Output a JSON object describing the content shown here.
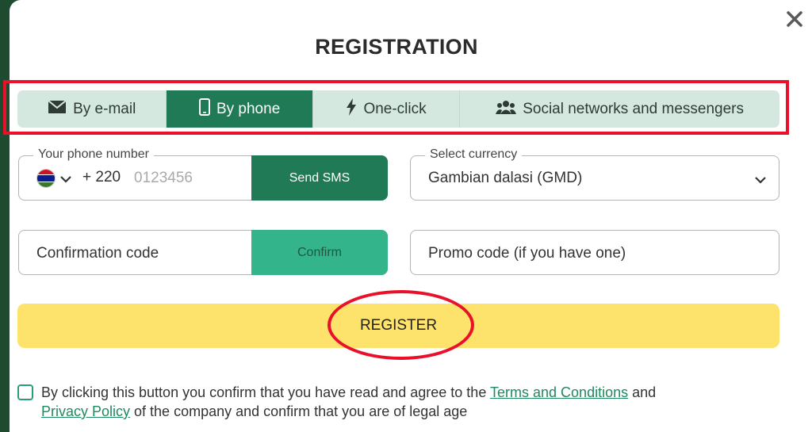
{
  "modal": {
    "title": "REGISTRATION",
    "close_icon": "close-icon"
  },
  "tabs": [
    {
      "label": "By e-mail",
      "icon": "envelope-icon",
      "active": false
    },
    {
      "label": "By phone",
      "icon": "phone-icon",
      "active": true
    },
    {
      "label": "One-click",
      "icon": "lightning-icon",
      "active": false
    },
    {
      "label": "Social networks and messengers",
      "icon": "users-icon",
      "active": false
    }
  ],
  "phone": {
    "legend": "Your phone number",
    "country_prefix": "+ 220",
    "placeholder": "0123456",
    "send_sms_label": "Send SMS"
  },
  "currency": {
    "legend": "Select currency",
    "selected": "Gambian dalasi (GMD)"
  },
  "confirmation": {
    "placeholder": "Confirmation code",
    "confirm_label": "Confirm"
  },
  "promo": {
    "placeholder": "Promo code (if you have one)"
  },
  "register_label": "REGISTER",
  "agreement": {
    "text_before": "By clicking this button you confirm that you have read and agree to the ",
    "terms_link": "Terms and Conditions",
    "text_middle": " and ",
    "privacy_link": "Privacy Policy",
    "text_after": " of the company and confirm that you are of legal age"
  },
  "colors": {
    "accent_green": "#1f7a55",
    "confirm_green": "#33b48a",
    "register_yellow": "#fde26b",
    "annotation_red": "#e8102a",
    "tab_bg": "#d5e8e0"
  }
}
